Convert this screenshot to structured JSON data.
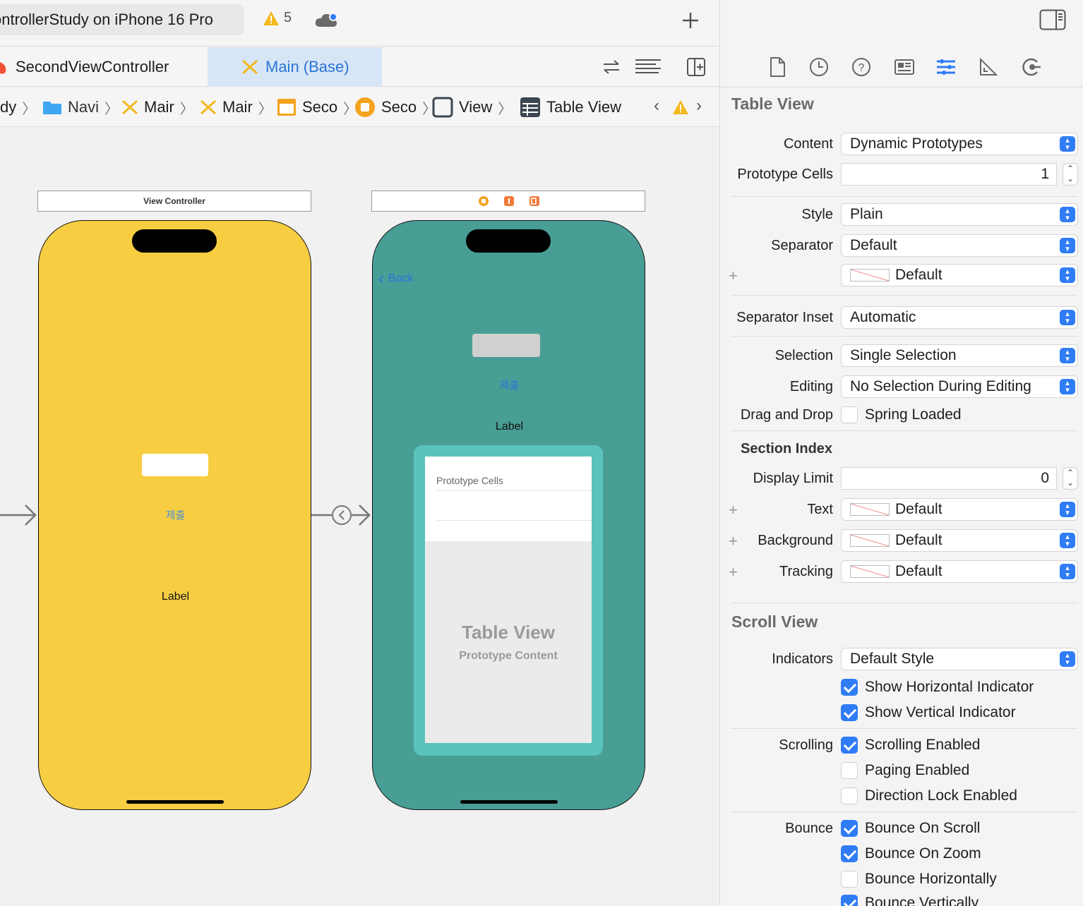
{
  "toolbar": {
    "scheme": "ontrollerStudy on iPhone 16 Pro",
    "warnings": "5"
  },
  "tabs": [
    {
      "label": "SecondViewController"
    },
    {
      "label": "Main (Base)"
    }
  ],
  "breadcrumb": {
    "items": [
      "dy",
      "Navi",
      "Mair",
      "Mair",
      "Seco",
      "Seco",
      "View",
      "Table View"
    ]
  },
  "canvas": {
    "vc_title": "View Controller",
    "vc_button": "제출",
    "vc_label": "Label",
    "second_back": "Back",
    "second_button": "제출",
    "second_label": "Label",
    "prototype_cells": "Prototype Cells",
    "table_view_title": "Table View",
    "table_view_subtitle": "Prototype Content"
  },
  "inspector": {
    "table_view_header": "Table View",
    "content_label": "Content",
    "content_value": "Dynamic Prototypes",
    "prototype_cells_label": "Prototype Cells",
    "prototype_cells_value": "1",
    "style_label": "Style",
    "style_value": "Plain",
    "separator_label": "Separator",
    "separator_value": "Default",
    "separator_color": "Default",
    "separator_inset_label": "Separator Inset",
    "separator_inset_value": "Automatic",
    "selection_label": "Selection",
    "selection_value": "Single Selection",
    "editing_label": "Editing",
    "editing_value": "No Selection During Editing",
    "drag_drop_label": "Drag and Drop",
    "spring_loaded": "Spring Loaded",
    "section_index_header": "Section Index",
    "display_limit_label": "Display Limit",
    "display_limit_value": "0",
    "text_label": "Text",
    "text_value": "Default",
    "background_label": "Background",
    "background_value": "Default",
    "tracking_label": "Tracking",
    "tracking_value": "Default",
    "scroll_view_header": "Scroll View",
    "indicators_label": "Indicators",
    "indicators_value": "Default Style",
    "show_horizontal": "Show Horizontal Indicator",
    "show_vertical": "Show Vertical Indicator",
    "scrolling_label": "Scrolling",
    "scrolling_enabled": "Scrolling Enabled",
    "paging_enabled": "Paging Enabled",
    "direction_lock": "Direction Lock Enabled",
    "bounce_label": "Bounce",
    "bounce_on_scroll": "Bounce On Scroll",
    "bounce_on_zoom": "Bounce On Zoom",
    "bounce_horizontally": "Bounce Horizontally",
    "bounce_vertically": "Bounce Vertically"
  },
  "colors": {
    "vc_background": "#f7ce42",
    "second_background": "#489e95",
    "table_border": "#5bc3bb",
    "accent": "#2f7cf6"
  }
}
